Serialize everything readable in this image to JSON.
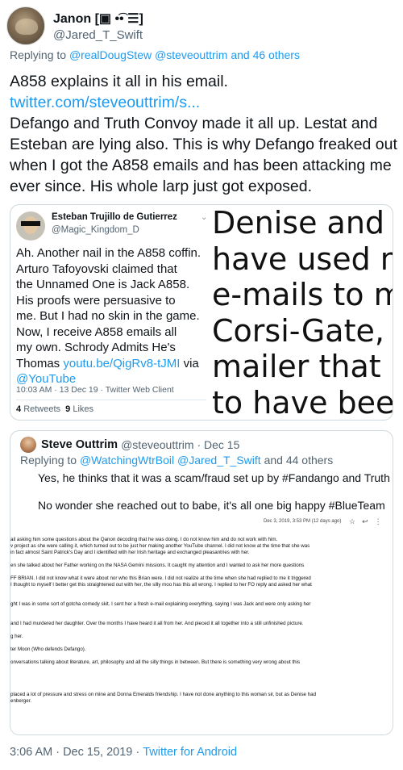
{
  "author": {
    "display_name": "Janon [▣ •͡• ☰]",
    "handle": "@Jared_T_Swift"
  },
  "replying": {
    "prefix": "Replying to ",
    "links": "@realDougStew @steveouttrim",
    "suffix": " and 46 others"
  },
  "tweet": {
    "lines": [
      "A858 explains it all in his email.",
      "twitter.com/steveouttrim/s...",
      "Defango and Truth Convoy made it all up. Lestat and",
      "Esteban are lying also.  This is why Defango freaked out",
      "when I got the A858 emails and has been attacking me",
      "ever since. His whole larp just got exposed."
    ]
  },
  "quote1": {
    "name": "Esteban Trujillo de Gutierrez",
    "handle": "@Magic_Kingdom_D",
    "body_lines": [
      "Ah. Another nail in the A858 coffin.",
      "Arturo Tafoyovski claimed that",
      "the Unnamed One is Jack A858.",
      "His proofs were persuasive to",
      "me. But I had no skin in the game.",
      "Now, I receive A858 emails all",
      "my own. Schrody Admits He's"
    ],
    "last_line_prefix": "Thomas ",
    "youtube_link": "youtu.be/QigRv8-tJMI",
    "via": " via",
    "youtube_handle": "@YouTube",
    "meta": "10:03 AM · 13 Dec 19 · Twitter Web Client",
    "retweets": "4",
    "retweets_label": "Retweets",
    "likes": "9",
    "likes_label": "Likes",
    "big_lines": [
      "Denise and De",
      "have used my",
      "e-mails to mal",
      "Corsi-Gate, an",
      "mailer that ap",
      "to have been h"
    ]
  },
  "quote2": {
    "name": "Steve Outtrim",
    "handle": "@steveouttrim · Dec 15",
    "reply_prefix": "Replying to ",
    "reply_links": "@WatchingWtrBoil @Jared_T_Swift",
    "reply_suffix": " and 44 others",
    "text1": "Yes, he thinks that it was a scam/fraud set up by #Fandango and Truth Convoy",
    "text2": "No wonder she reached out to babe, it's all one big happy #BlueTeam",
    "email_date": "Dec 3, 2019, 3:53 PM (12 days ago)",
    "email_lines": [
      "ail asking him some questions about the Qanon decoding that he was doing. I do not know him and do not work with him.",
      "v project as she were calling it, which turned out to be just her making another YouTube channel. I did not know at the time that she was",
      " in fact almost Saint Patrick's Day and I identified with her Irish heritage and exchanged pleasantries with her.",
      "",
      "en she talked about her Father working on the NASA Gemini missions. It caught my attention and I wanted to ask her more questions",
      "",
      "FF BRIAN. I did not know what it were about nor who this Brian were. I did not realize at the time when she had replied to me it triggered",
      " I thought to myself I better get this straightened out with her, the silly moo has this all wrong. I replied to her FO reply and asked her what",
      "",
      "",
      "ght I was in some sort of gotcha comedy skit. I sent her a fresh e-mail explaining everything, saying I was Jack and were only asking her",
      "",
      "",
      "and I had murdered her daughter. Over the months I have heard it all from her. And pieced it all together into a still unfinished picture.",
      "",
      "g her.",
      "",
      "ter Moon (Who defends Defango).",
      "",
      "onversations talking about literature, art, philosophy and all the silly things in between. But there is something very wrong about this",
      "",
      "",
      "",
      "",
      " placed a lot of pressure and stress on mine and Donna Emeralds friendship. I have not done anything to this woman sir, but as Denise had",
      "enberger."
    ]
  },
  "footer": {
    "time": "3:06 AM · Dec 15, 2019",
    "source": "Twitter for Android"
  }
}
